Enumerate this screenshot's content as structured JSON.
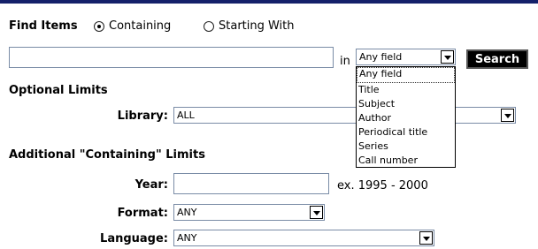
{
  "find": {
    "label": "Find Items",
    "containing_label": "Containing",
    "starting_label": "Starting With"
  },
  "search": {
    "query_value": "",
    "in_label": "in",
    "field_selected": "Any field",
    "field_options": [
      "Any field",
      "Title",
      "Subject",
      "Author",
      "Periodical title",
      "Series",
      "Call number"
    ],
    "button_label": "Search"
  },
  "optional": {
    "heading": "Optional Limits",
    "library_label": "Library:",
    "library_value": "ALL"
  },
  "additional": {
    "heading": "Additional \"Containing\" Limits",
    "year_label": "Year:",
    "year_value": "",
    "year_hint": "ex. 1995 - 2000",
    "format_label": "Format:",
    "format_value": "ANY",
    "language_label": "Language:",
    "language_value": "ANY"
  }
}
